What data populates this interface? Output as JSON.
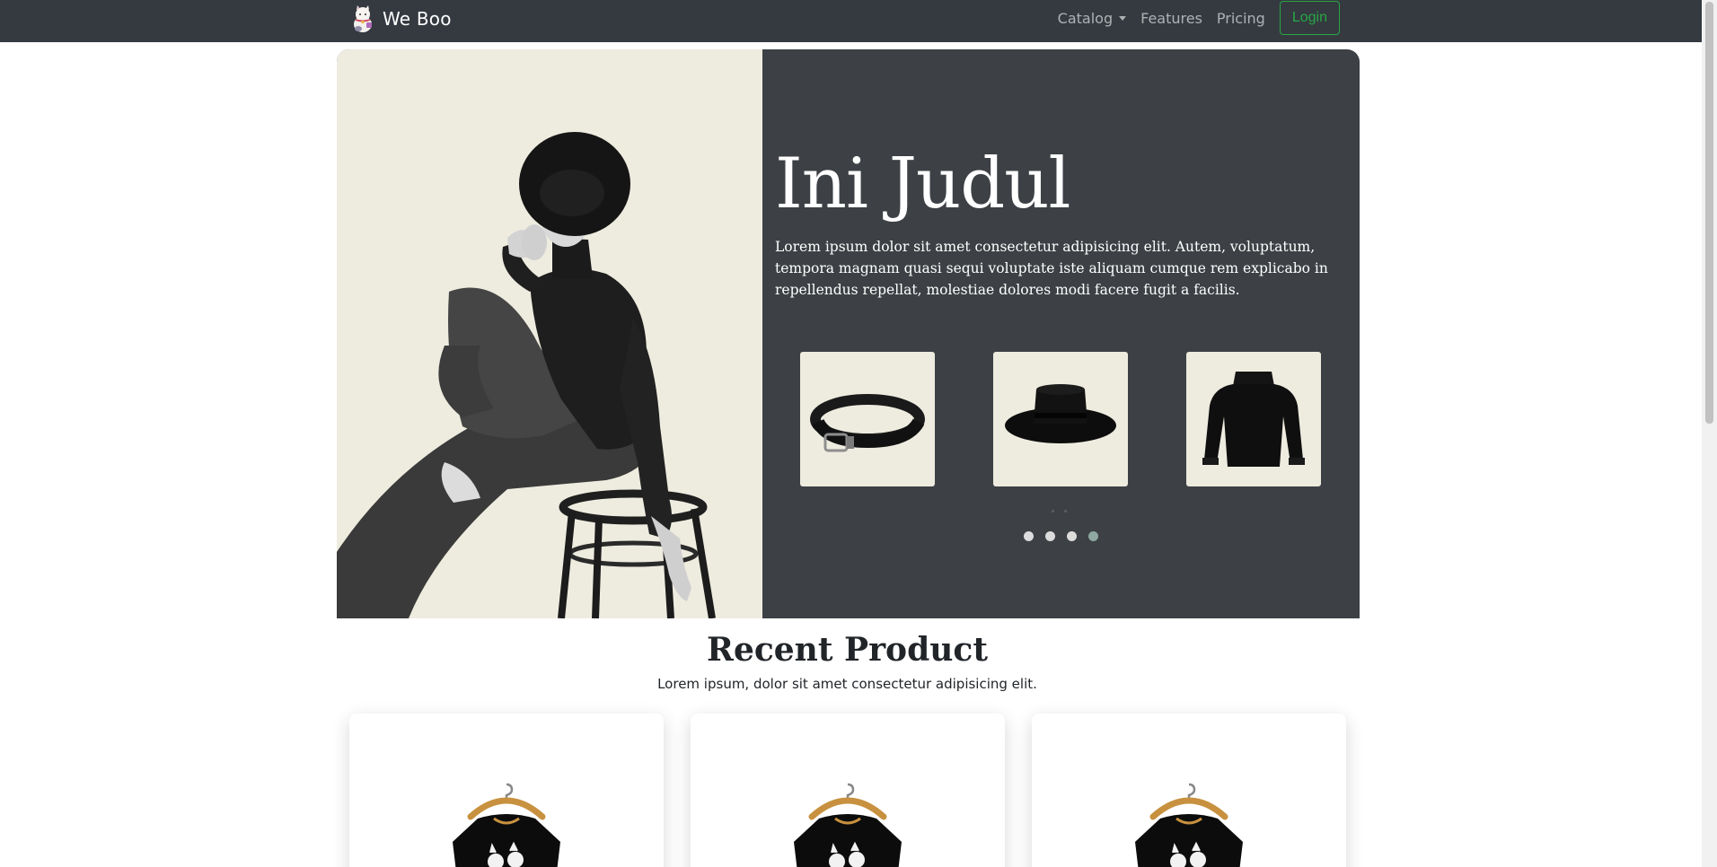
{
  "brand": {
    "name": "We Boo",
    "logo_icon": "lucky-cat-icon"
  },
  "nav": {
    "catalog": "Catalog",
    "features": "Features",
    "pricing": "Pricing",
    "login": "Login"
  },
  "hero": {
    "title": "Ini Judul",
    "text": "Lorem ipsum dolor sit amet consectetur adipisicing elit. Autem, voluptatum, tempora magnam quasi sequi voluptate iste aliquam cumque rem explicabo in repellendus repellat, molestiae dolores modi facere fugit a facilis.",
    "thumbnails": [
      {
        "icon": "belt-icon"
      },
      {
        "icon": "hat-icon"
      },
      {
        "icon": "sweater-icon"
      }
    ],
    "carousel": {
      "slides": 4,
      "active_index": 3
    }
  },
  "recent": {
    "title": "Recent Product",
    "subtitle": "Lorem ipsum, dolor sit amet consectetur adipisicing elit.",
    "products": [
      {
        "icon": "tshirt-on-hanger-icon"
      },
      {
        "icon": "tshirt-on-hanger-icon"
      },
      {
        "icon": "tshirt-on-hanger-icon"
      }
    ]
  },
  "colors": {
    "navbar_bg": "#343a40",
    "hero_dark": "#3d4145",
    "hero_cream": "#eeecdf",
    "login_green": "#28a745",
    "active_dot": "#8fa8a0"
  }
}
